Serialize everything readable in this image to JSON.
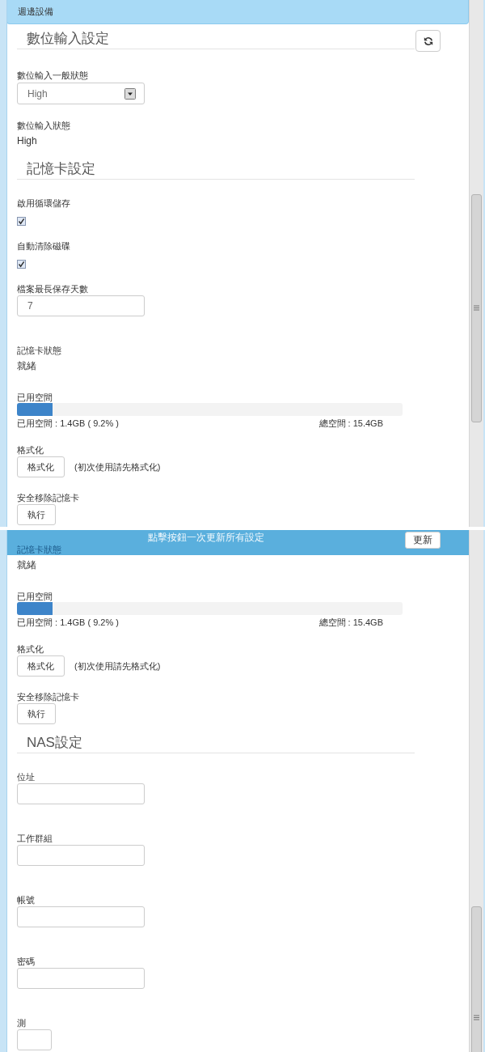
{
  "views": [
    {
      "panel_title": "週邊設備",
      "sections": [
        {
          "heading": "數位輸入設定",
          "refresh_button": true,
          "fields": [
            {
              "kind": "select",
              "label": "數位輸入一般狀態",
              "value": "High"
            },
            {
              "kind": "text",
              "label": "數位輸入狀態",
              "value": "High"
            }
          ]
        },
        {
          "heading": "記憶卡設定",
          "refresh_button": false,
          "fields": [
            {
              "kind": "checkbox",
              "label": "啟用循環儲存",
              "checked": true
            },
            {
              "kind": "checkbox",
              "label": "自動清除磁碟",
              "checked": true
            },
            {
              "kind": "input",
              "label": "檔案最長保存天數",
              "value": "7"
            },
            {
              "kind": "text",
              "label": "記憶卡狀態",
              "value": "就緒"
            },
            {
              "kind": "progress",
              "label": "已用空間",
              "level": 0.092,
              "used": "已用空間 : 1.4GB ( 9.2% )",
              "total": "總空間 : 15.4GB"
            },
            {
              "kind": "button",
              "label": "格式化",
              "button": "格式化",
              "note": "(初次使用請先格式化)"
            },
            {
              "kind": "button",
              "label": "安全移除記憶卡",
              "button": "執行"
            }
          ]
        }
      ]
    },
    {
      "save_bar": {
        "hint": "點擊按鈕一次更新所有設定",
        "button": "更新"
      },
      "sections": [
        {
          "fields": [
            {
              "kind": "text",
              "label": "記憶卡狀態",
              "value": "就緒"
            },
            {
              "kind": "progress",
              "label": "已用空間",
              "level": 0.092,
              "used": "已用空間 : 1.4GB ( 9.2% )",
              "total": "總空間 : 15.4GB"
            },
            {
              "kind": "button",
              "label": "格式化",
              "button": "格式化",
              "note": "(初次使用請先格式化)"
            },
            {
              "kind": "button",
              "label": "安全移除記憶卡",
              "button": "執行"
            }
          ]
        },
        {
          "heading": "NAS設定",
          "refresh_button": false,
          "fields": [
            {
              "kind": "input",
              "label": "位址"
            },
            {
              "kind": "input",
              "label": "工作群組"
            },
            {
              "kind": "input",
              "label": "帳號"
            },
            {
              "kind": "input",
              "label": "密碼"
            },
            {
              "kind": "button",
              "label": "測"
            }
          ]
        }
      ]
    }
  ]
}
